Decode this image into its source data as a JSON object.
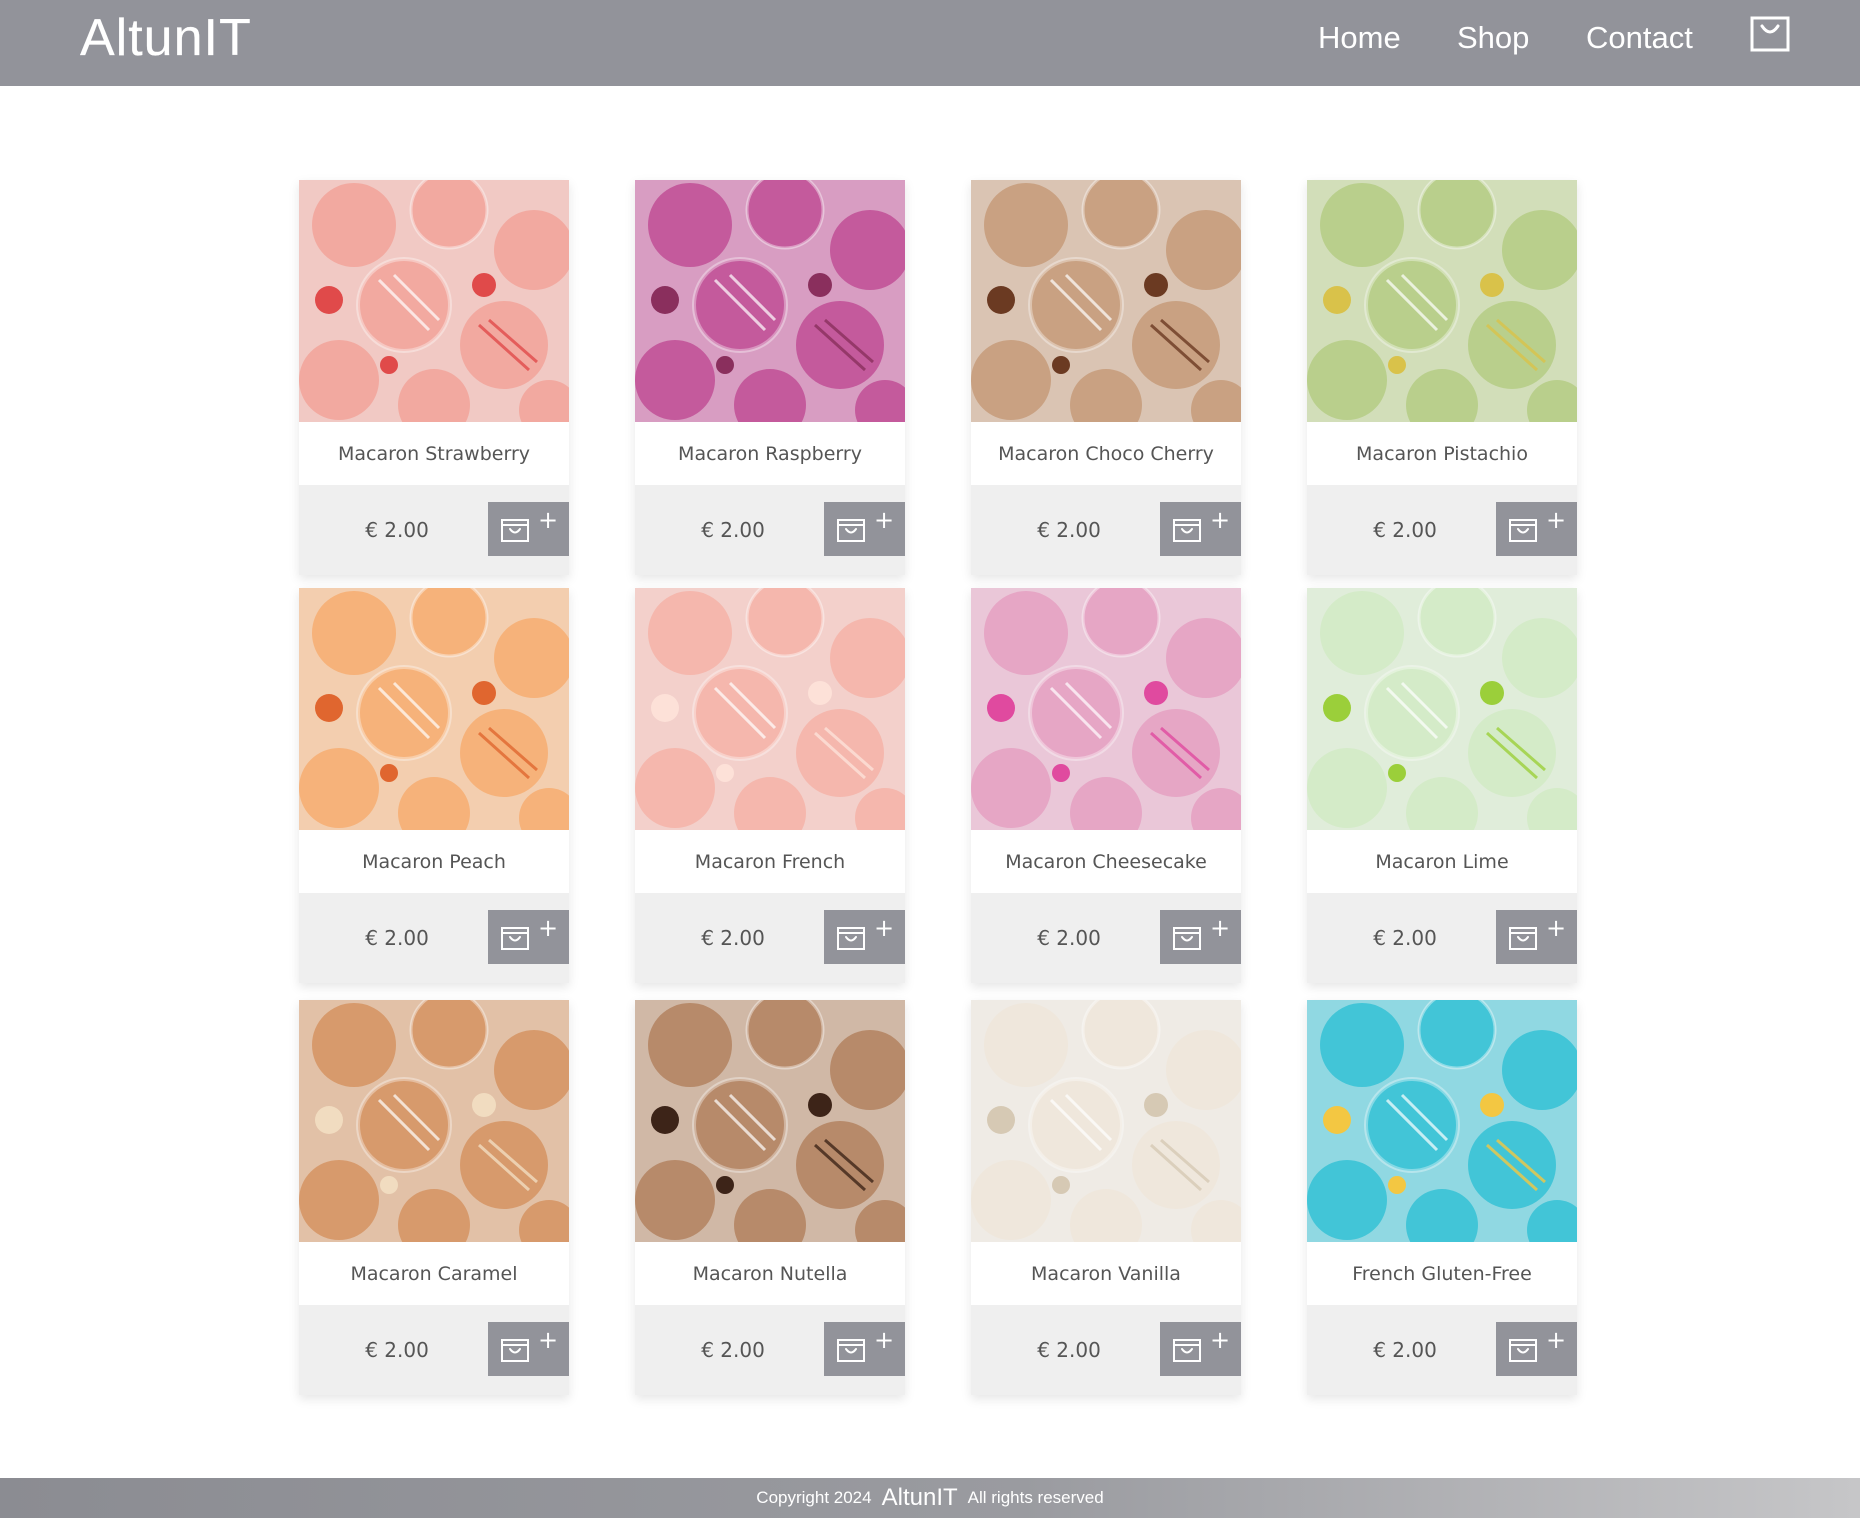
{
  "header": {
    "logo": "AltunIT",
    "nav": [
      {
        "label": "Home"
      },
      {
        "label": "Shop"
      },
      {
        "label": "Contact"
      }
    ],
    "cart_icon": "shopping-bag-icon"
  },
  "products": [
    {
      "name": "Macaron Strawberry",
      "price": "€ 2.00",
      "color": "#f2a9a0",
      "accent": "#e04a4a"
    },
    {
      "name": "Macaron Raspberry",
      "price": "€ 2.00",
      "color": "#c45a9c",
      "accent": "#8a2f5d"
    },
    {
      "name": "Macaron Choco Cherry",
      "price": "€ 2.00",
      "color": "#c9a182",
      "accent": "#6b3a22"
    },
    {
      "name": "Macaron Pistachio",
      "price": "€ 2.00",
      "color": "#b9cf8c",
      "accent": "#d9c24a"
    },
    {
      "name": "Macaron Peach",
      "price": "€ 2.00",
      "color": "#f6b27a",
      "accent": "#e0662f"
    },
    {
      "name": "Macaron French",
      "price": "€ 2.00",
      "color": "#f5b7ad",
      "accent": "#fde1d8"
    },
    {
      "name": "Macaron Cheesecake",
      "price": "€ 2.00",
      "color": "#e6a6c5",
      "accent": "#e04a9f"
    },
    {
      "name": "Macaron Lime",
      "price": "€ 2.00",
      "color": "#d4ebc8",
      "accent": "#9bcf3a"
    },
    {
      "name": "Macaron Caramel",
      "price": "€ 2.00",
      "color": "#d79a6c",
      "accent": "#f1dcc0"
    },
    {
      "name": "Macaron Nutella",
      "price": "€ 2.00",
      "color": "#b78a6a",
      "accent": "#3d2418"
    },
    {
      "name": "Macaron Vanilla",
      "price": "€ 2.00",
      "color": "#efe7dc",
      "accent": "#d6c9b4"
    },
    {
      "name": "French Gluten-Free",
      "price": "€ 2.00",
      "color": "#42c5d7",
      "accent": "#f3c742"
    }
  ],
  "card_button": {
    "icon": "shopping-bag-icon",
    "plus_icon": "plus-icon",
    "plus_glyph": "+"
  },
  "footer": {
    "copyright": "Copyright 2024",
    "brand": "AltunIT",
    "rights": "All rights reserved"
  },
  "colors": {
    "header_bg": "#92939a",
    "card_bg": "#efefef",
    "text": "#555555"
  }
}
